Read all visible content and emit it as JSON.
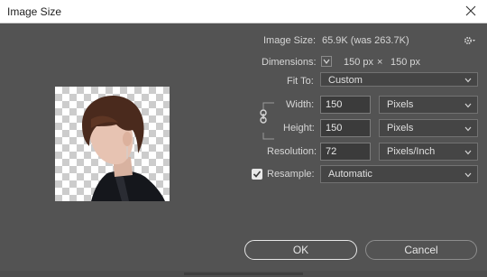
{
  "window": {
    "title": "Image Size"
  },
  "info": {
    "image_size_label": "Image Size:",
    "image_size_value": "65.9K (was 263.7K)",
    "dimensions_label": "Dimensions:",
    "dimensions_width": "150 px",
    "dimensions_separator": "×",
    "dimensions_height": "150 px"
  },
  "fit_to": {
    "label": "Fit To:",
    "value": "Custom"
  },
  "width": {
    "label": "Width:",
    "value": "150",
    "unit": "Pixels"
  },
  "height": {
    "label": "Height:",
    "value": "150",
    "unit": "Pixels"
  },
  "resolution": {
    "label": "Resolution:",
    "value": "72",
    "unit": "Pixels/Inch"
  },
  "resample": {
    "label": "Resample:",
    "checked": true,
    "value": "Automatic"
  },
  "buttons": {
    "ok": "OK",
    "cancel": "Cancel"
  },
  "colors": {
    "dialog_bg": "#535353",
    "text": "#d6d6d6",
    "field_bg": "#3b3b3b",
    "dropdown_bg": "#454545"
  },
  "icons": {
    "close": "close-icon",
    "settings": "gear-icon",
    "dimensions_toggle": "chevron-down-icon",
    "constrain": "link-icon",
    "resample": "checkbox-checked-icon",
    "dropdown": "chevron-down-icon"
  }
}
